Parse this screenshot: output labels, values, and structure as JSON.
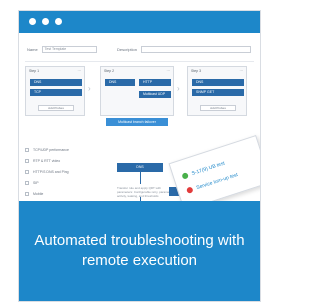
{
  "form": {
    "name_label": "Name",
    "name_value": "Test Template",
    "description_label": "Description"
  },
  "steps": [
    {
      "label": "Step 1",
      "blocks": [
        "DNS",
        "TCP"
      ],
      "add_label": "Add Probes"
    },
    {
      "label": "Step 2",
      "blocks": [
        "DNS",
        "HTTP",
        "Multicast UDP"
      ],
      "add_label": ""
    },
    {
      "label": "Step 3",
      "blocks": [
        "DNS",
        "SNMP GET"
      ],
      "add_label": "Add Probes"
    }
  ],
  "wide_action": "Multicast branch failover",
  "sidebar": {
    "items": [
      "TCP/UDP performance",
      "RTP & RTT video",
      "HTTP/S DNS and Ping",
      "SIP",
      "Mobile",
      "S-TCL / TWAMP"
    ]
  },
  "canvas": {
    "blocks": [
      "DNS",
      "TCP",
      "Multicast UDP",
      "SIP"
    ],
    "note": "Transfer rule and apply QRT with parameters: Configurable retry, parameters, activity, leaking, and thresholds"
  },
  "popup": {
    "line1": "S-17(9) UB test",
    "line2": "Service turn-up test"
  },
  "banner": {
    "text": "Automated troubleshooting with remote execution"
  },
  "colors": {
    "brand_blue": "#1d87c9",
    "block_blue": "#2a6aa8",
    "success": "#49b04a",
    "error": "#e23b3b"
  }
}
